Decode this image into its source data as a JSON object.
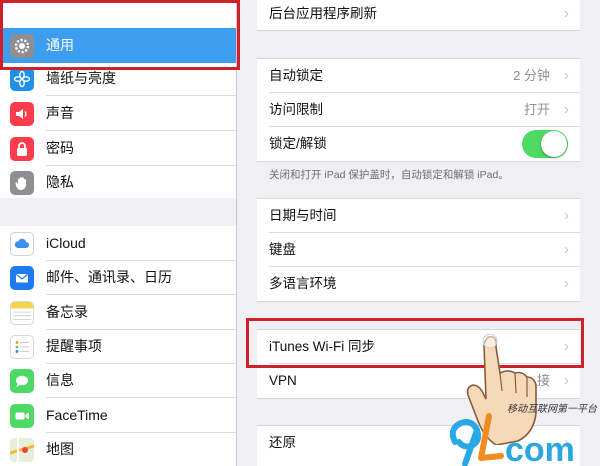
{
  "sidebar": {
    "groups": [
      {
        "items": [
          {
            "label": "通用",
            "icon": "gear-icon",
            "color": "#8e8e93",
            "selected": true
          },
          {
            "label": "墙纸与亮度",
            "icon": "flower-icon",
            "color": "#1f8fe8"
          },
          {
            "label": "声音",
            "icon": "speaker-icon",
            "color": "#ff3b4e"
          },
          {
            "label": "密码",
            "icon": "lock-icon",
            "color": "#ff3b4e"
          },
          {
            "label": "隐私",
            "icon": "hand-icon",
            "color": "#8e8e93"
          }
        ]
      },
      {
        "items": [
          {
            "label": "iCloud",
            "icon": "cloud-icon",
            "color": "#3d8ef3"
          },
          {
            "label": "邮件、通讯录、日历",
            "icon": "mail-icon",
            "color": "#1e7cf0"
          },
          {
            "label": "备忘录",
            "icon": "notes-icon",
            "color": "#f5d44a"
          },
          {
            "label": "提醒事项",
            "icon": "reminders-icon",
            "color": "#ffffff"
          },
          {
            "label": "信息",
            "icon": "message-icon",
            "color": "#4cd964"
          },
          {
            "label": "FaceTime",
            "icon": "video-icon",
            "color": "#4cd964"
          },
          {
            "label": "地图",
            "icon": "map-icon",
            "color": "#6fb3e8"
          }
        ]
      }
    ]
  },
  "detail": {
    "group1": [
      {
        "label": "后台应用程序刷新",
        "value": ""
      }
    ],
    "group2": [
      {
        "label": "自动锁定",
        "value": "2 分钟"
      },
      {
        "label": "访问限制",
        "value": "打开"
      },
      {
        "label": "锁定/解锁",
        "toggle_on": true
      }
    ],
    "footnote": "关闭和打开 iPad 保护盖时，自动锁定和解锁 iPad。",
    "group3": [
      {
        "label": "日期与时间"
      },
      {
        "label": "键盘"
      },
      {
        "label": "多语言环境"
      }
    ],
    "group4": [
      {
        "label": "iTunes Wi-Fi 同步"
      },
      {
        "label": "VPN",
        "value": "接"
      }
    ],
    "group5": [
      {
        "label": "还原"
      }
    ]
  },
  "chevron": "›",
  "watermark": {
    "logo": "9Lcom",
    "slogan": "移动互联网第一平台"
  },
  "colors": {
    "accent": "#3d9ef0",
    "highlight": "#d0202c",
    "toggle_on": "#4cd964"
  }
}
